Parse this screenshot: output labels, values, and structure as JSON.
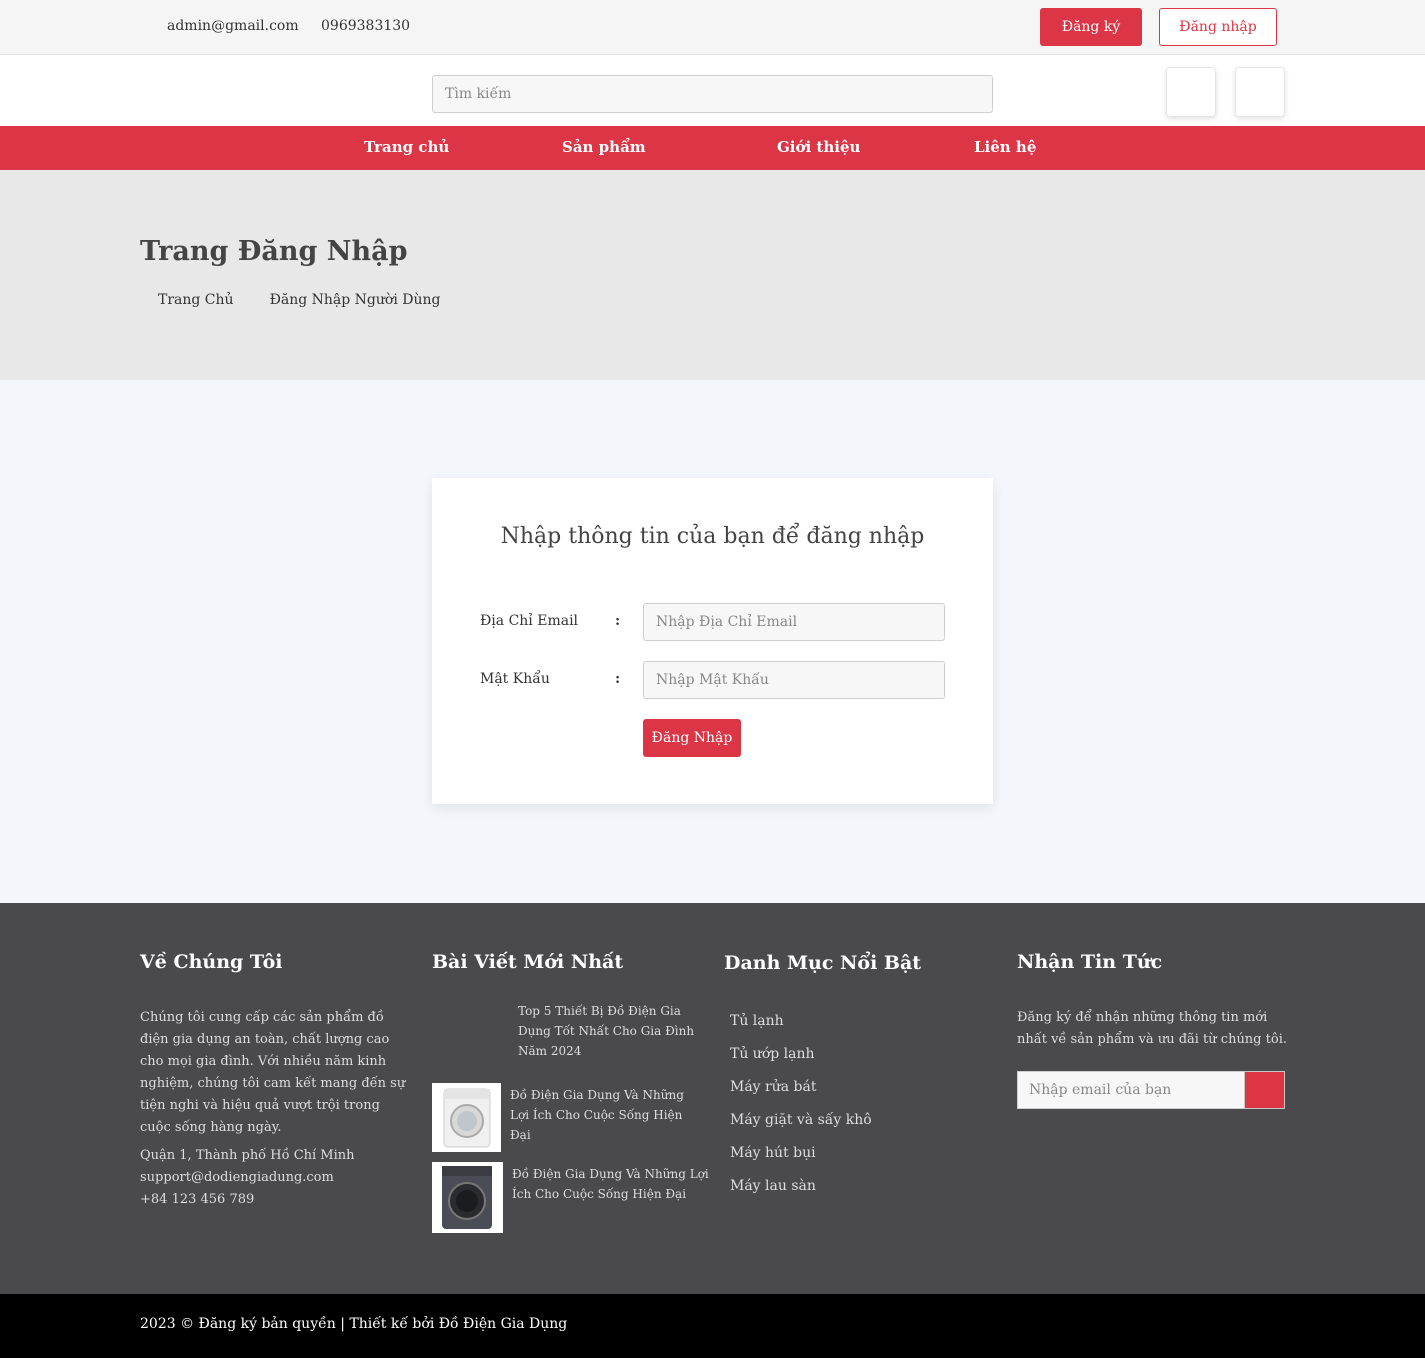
{
  "topbar": {
    "email": "admin@gmail.com",
    "phone": "0969383130",
    "register_label": "Đăng ký",
    "login_label": "Đăng nhập"
  },
  "header": {
    "search_placeholder": "Tìm kiếm",
    "icons": [
      "user-icon",
      "cart-icon"
    ]
  },
  "nav": {
    "items": [
      "Trang chủ",
      "Sản phẩm",
      "Giới thiệu",
      "Liên hệ"
    ]
  },
  "hero": {
    "title": "Trang Đăng Nhập",
    "breadcrumb": [
      "Trang Chủ",
      "Đăng Nhập Người Dùng"
    ]
  },
  "login_form": {
    "heading": "Nhập thông tin của bạn để đăng nhập",
    "email_label": "Địa Chỉ Email",
    "email_placeholder": "Nhập Địa Chỉ Email",
    "password_label": "Mật Khẩu",
    "password_placeholder": "Nhập Mật Khẩu",
    "colon": ":",
    "submit_label": "Đăng Nhập"
  },
  "footer": {
    "about": {
      "heading": "Về Chúng Tôi",
      "text": "Chúng tôi cung cấp các sản phẩm đồ điện gia dụng an toàn, chất lượng cao cho mọi gia đình. Với nhiều năm kinh nghiệm, chúng tôi cam kết mang đến sự tiện nghi và hiệu quả vượt trội trong cuộc sống hàng ngày.",
      "address": "Quận 1, Thành phố Hồ Chí Minh",
      "email": "support@dodiengiadung.com",
      "phone": "+84 123 456 789"
    },
    "posts": {
      "heading": "Bài Viết Mới Nhất",
      "items": [
        "Top 5 Thiết Bị Đồ Điện Gia Dụng Tốt Nhất Cho Gia Đình Năm 2024",
        "Đồ Điện Gia Dụng Và Những Lợi Ích Cho Cuộc Sống Hiện Đại",
        "Đồ Điện Gia Dụng Và Những Lợi Ích Cho Cuộc Sống Hiện Đại"
      ]
    },
    "categories": {
      "heading": "Danh Mục Nổi Bật",
      "items": [
        "Tủ lạnh",
        "Tủ ướp lạnh",
        "Máy rửa bát",
        "Máy giặt và sấy khô",
        "Máy hút bụi",
        "Máy lau sàn"
      ]
    },
    "newsletter": {
      "heading": "Nhận Tin Tức",
      "text": "Đăng ký để nhận những thông tin mới nhất về sản phẩm và ưu đãi từ chúng tôi.",
      "placeholder": "Nhập email của bạn"
    },
    "copyright": "2023 © Đăng ký bản quyền | Thiết kế bởi Đồ Điện Gia Dụng"
  },
  "colors": {
    "accent": "#dc3545",
    "footer_bg": "#4a4a4d",
    "hero_bg": "#e8e8e8",
    "main_bg": "#f3f6fb"
  }
}
